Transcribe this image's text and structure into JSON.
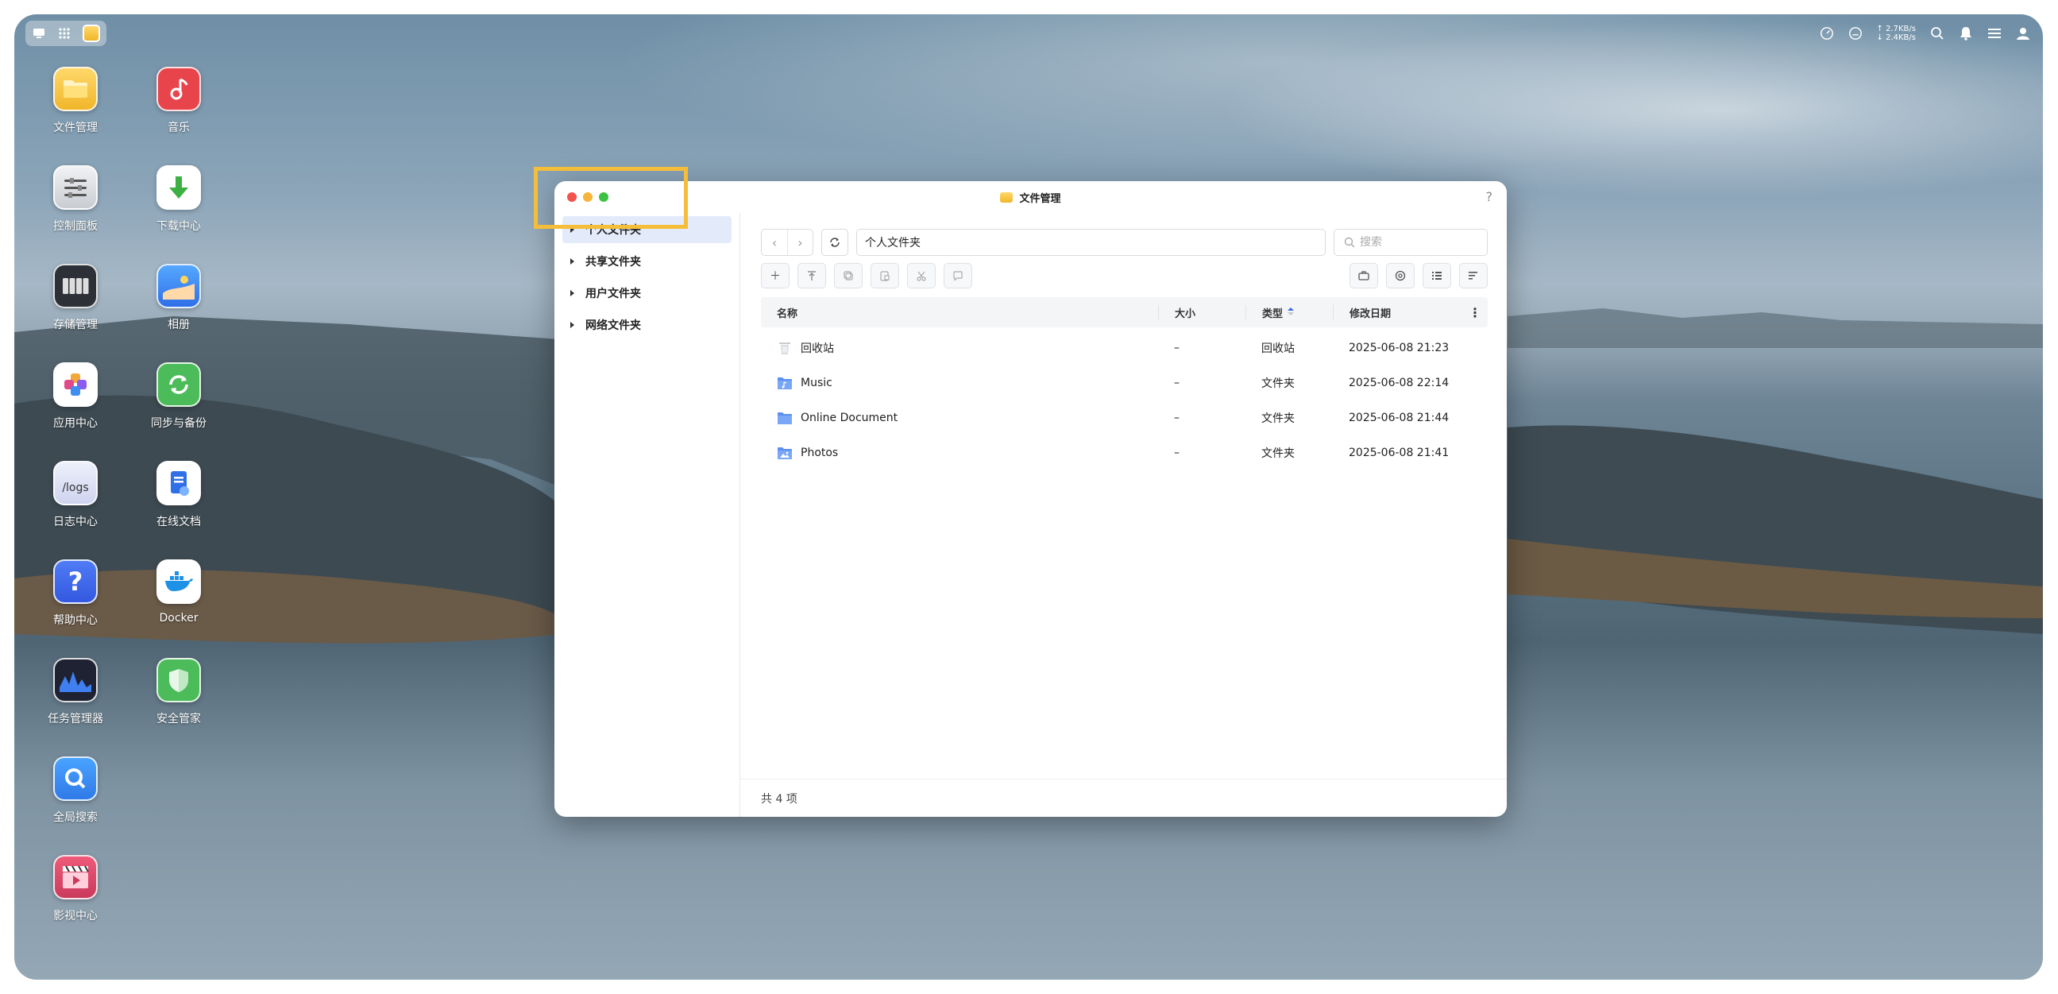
{
  "topbar": {
    "upload_rate": "↑ 2.7KB/s",
    "download_rate": "↓ 2.4KB/s"
  },
  "desktop_apps": [
    {
      "label": "文件管理",
      "icon": "folder-icon",
      "color": "#f4c542"
    },
    {
      "label": "音乐",
      "icon": "music-note-icon",
      "color": "#e8444c"
    },
    {
      "label": "控制面板",
      "icon": "sliders-icon",
      "color": "#cfd2d6"
    },
    {
      "label": "下载中心",
      "icon": "download-arrow-icon",
      "color": "#ffffff"
    },
    {
      "label": "存储管理",
      "icon": "storage-drives-icon",
      "color": "#3a3d44"
    },
    {
      "label": "相册",
      "icon": "photo-landscape-icon",
      "color": "#3d8ef0"
    },
    {
      "label": "应用中心",
      "icon": "app-puzzle-icon",
      "color": "#ffffff"
    },
    {
      "label": "同步与备份",
      "icon": "sync-icon",
      "color": "#4cbb5a"
    },
    {
      "label": "日志中心",
      "icon": "logs-icon",
      "color": "#e4e7f7"
    },
    {
      "label": "在线文档",
      "icon": "online-document-icon",
      "color": "#ffffff"
    },
    {
      "label": "帮助中心",
      "icon": "question-icon",
      "color": "#3d6cf0"
    },
    {
      "label": "Docker",
      "icon": "docker-whale-icon",
      "color": "#ffffff"
    },
    {
      "label": "任务管理器",
      "icon": "activity-chart-icon",
      "color": "#1e2233"
    },
    {
      "label": "安全管家",
      "icon": "shield-icon",
      "color": "#4cbb5a"
    },
    {
      "label": "全局搜索",
      "icon": "search-icon",
      "color": "#2f8cf0"
    },
    {
      "label": "影视中心",
      "icon": "clapperboard-icon",
      "color": "#e04a6a"
    }
  ],
  "logs_tile_text": "/logs",
  "window": {
    "title": "文件管理",
    "help": "?",
    "sidebar": [
      {
        "label": "个人文件夹",
        "active": true
      },
      {
        "label": "共享文件夹",
        "active": false
      },
      {
        "label": "用户文件夹",
        "active": false
      },
      {
        "label": "网络文件夹",
        "active": false
      }
    ],
    "path": "个人文件夹",
    "search_placeholder": "搜索",
    "columns": {
      "name": "名称",
      "size": "大小",
      "type": "类型",
      "date": "修改日期"
    },
    "files": [
      {
        "name": "回收站",
        "size": "–",
        "type": "回收站",
        "date": "2025-06-08 21:23",
        "icon": "trash-icon"
      },
      {
        "name": "Music",
        "size": "–",
        "type": "文件夹",
        "date": "2025-06-08 22:14",
        "icon": "music-folder-icon"
      },
      {
        "name": "Online Document",
        "size": "–",
        "type": "文件夹",
        "date": "2025-06-08 21:44",
        "icon": "folder-icon"
      },
      {
        "name": "Photos",
        "size": "–",
        "type": "文件夹",
        "date": "2025-06-08 21:41",
        "icon": "photo-folder-icon"
      }
    ],
    "footer": "共 4 项"
  },
  "colors": {
    "accent": "#3d6cf0",
    "highlight": "#f5be3a",
    "close": "#f4524c",
    "minimize": "#f6b43b",
    "maximize": "#3ec246"
  }
}
